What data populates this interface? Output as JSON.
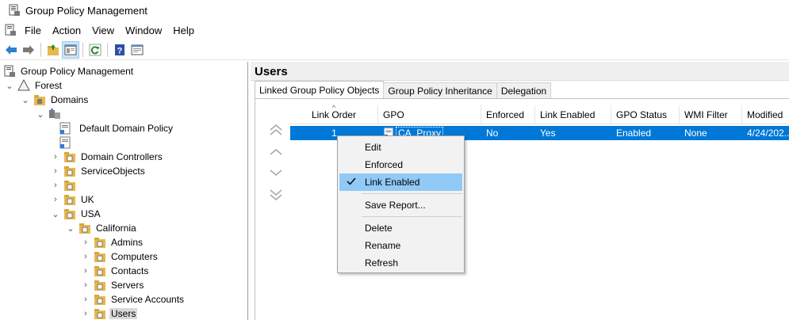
{
  "window": {
    "title": "Group Policy Management"
  },
  "menu": {
    "items": [
      "File",
      "Action",
      "View",
      "Window",
      "Help"
    ]
  },
  "toolbar": {
    "buttons": [
      "back-icon",
      "forward-icon",
      "up-folder-icon",
      "show-hide-tree-icon",
      "refresh-icon",
      "help-icon",
      "properties-icon"
    ]
  },
  "tree": {
    "root": "Group Policy Management",
    "forest": "Forest",
    "domains": "Domains",
    "domain_name": "",
    "default_domain_policy": "Default Domain Policy",
    "domain_controllers": "Domain Controllers",
    "service_objects": "ServiceObjects",
    "unnamed_ou": "",
    "uk": "UK",
    "usa": "USA",
    "california": "California",
    "admins": "Admins",
    "computers": "Computers",
    "contacts": "Contacts",
    "servers": "Servers",
    "service_accounts": "Service Accounts",
    "users": "Users"
  },
  "right_pane": {
    "title": "Users",
    "tabs": [
      "Linked Group Policy Objects",
      "Group Policy Inheritance",
      "Delegation"
    ],
    "active_tab": "Linked Group Policy Objects"
  },
  "grid": {
    "columns": [
      "Link Order",
      "GPO",
      "Enforced",
      "Link Enabled",
      "GPO Status",
      "WMI Filter",
      "Modified"
    ],
    "sort_column": "Link Order",
    "rows": [
      {
        "link_order": "1",
        "gpo": "CA_Proxy",
        "enforced": "No",
        "link_enabled": "Yes",
        "gpo_status": "Enabled",
        "wmi_filter": "None",
        "modified": "4/24/202..."
      }
    ]
  },
  "context_menu": {
    "edit": "Edit",
    "enforced": "Enforced",
    "link_enabled": "Link Enabled",
    "link_enabled_checked": true,
    "save_report": "Save Report...",
    "delete": "Delete",
    "rename": "Rename",
    "refresh": "Refresh"
  },
  "colors": {
    "selection": "#0078d7",
    "menu_highlight": "#91c9f7",
    "folder": "#e8b84a"
  }
}
